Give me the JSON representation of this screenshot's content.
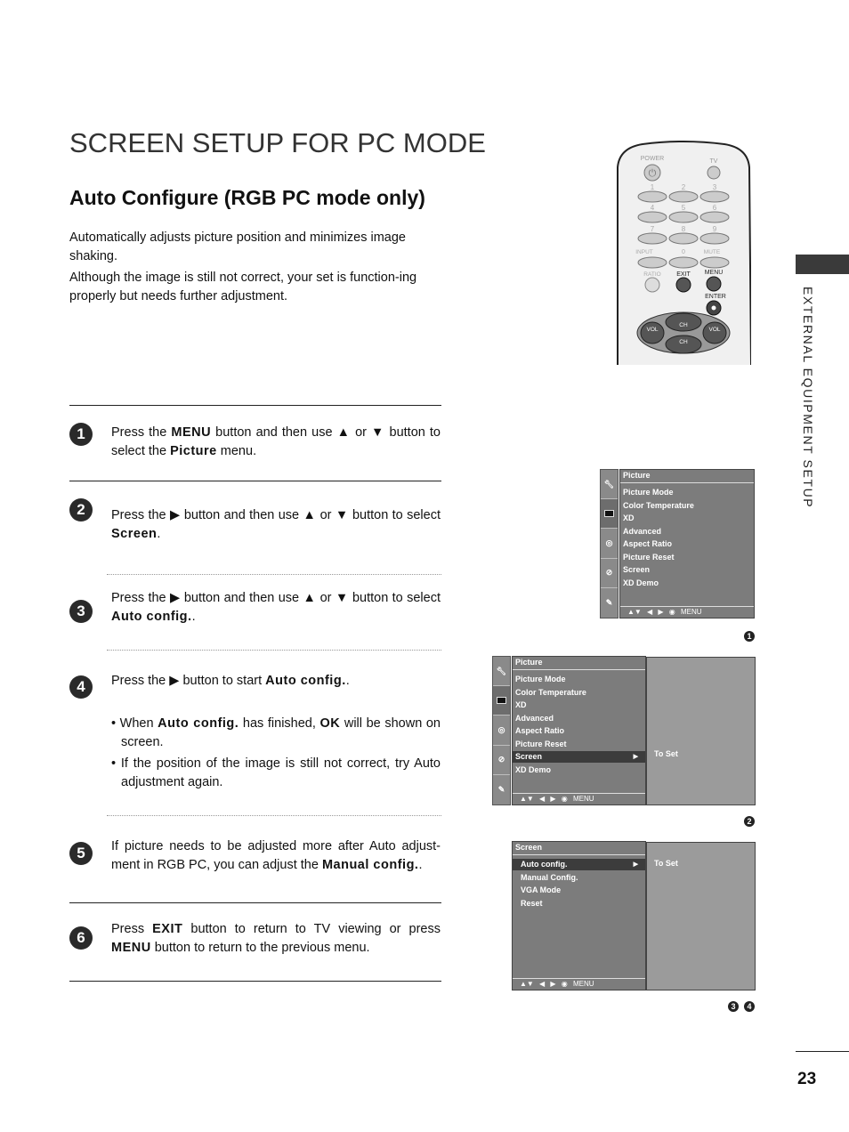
{
  "page": {
    "title": "SCREEN SETUP FOR PC MODE",
    "section_title": "Auto Configure (RGB PC mode only)",
    "intro": [
      "Automatically adjusts picture position and minimizes image shaking.",
      "Although the image is still not correct, your set is function-ing properly but needs further adjustment."
    ],
    "side_label": "EXTERNAL EQUIPMENT SETUP",
    "page_number": "23"
  },
  "steps": [
    {
      "num": "1",
      "parts": [
        "Press the ",
        "MENU",
        " button and then use ▲ or ▼ button to select the ",
        "Picture",
        " menu."
      ]
    },
    {
      "num": "2",
      "parts": [
        "Press the ▶ button and then use ▲ or ▼ button to select ",
        "Screen",
        "."
      ]
    },
    {
      "num": "3",
      "parts": [
        "Press the ▶ button and then use ▲ or ▼ button to select ",
        "Auto config.",
        "."
      ]
    },
    {
      "num": "4",
      "parts": [
        "Press the ▶ button to start ",
        "Auto config.",
        "."
      ],
      "bullets": [
        [
          "• When ",
          "Auto config.",
          " has finished, ",
          "OK",
          " will be shown on screen."
        ],
        [
          "• If the position of the image is still not correct, try Auto adjustment again."
        ]
      ]
    },
    {
      "num": "5",
      "parts": [
        "If picture needs to be adjusted more after Auto adjust-ment in RGB PC, you can adjust the ",
        "Manual config.",
        "."
      ]
    },
    {
      "num": "6",
      "parts": [
        "Press ",
        "EXIT",
        " button to return to TV viewing or press ",
        "MENU",
        " button to return to the previous menu."
      ]
    }
  ],
  "remote": {
    "power": "POWER",
    "tv": "TV",
    "digits": [
      "1",
      "2",
      "3",
      "4",
      "5",
      "6",
      "7",
      "8",
      "9"
    ],
    "input": "INPUT",
    "zero": "0",
    "mute": "MUTE",
    "ratio": "RATIO",
    "exit": "EXIT",
    "menu": "MENU",
    "enter": "ENTER",
    "ch": "CH",
    "vol": "VOL"
  },
  "osd1": {
    "header": "Picture",
    "items": [
      "Picture Mode",
      "Color Temperature",
      "XD",
      "Advanced",
      "Aspect Ratio",
      "Picture Reset",
      "Screen",
      "XD Demo"
    ],
    "footer": "▲▼ ◀ ▶ ◉ MENU",
    "badge": "1"
  },
  "osd2": {
    "header": "Picture",
    "items": [
      "Picture Mode",
      "Color Temperature",
      "XD",
      "Advanced",
      "Aspect Ratio",
      "Picture Reset",
      "Screen",
      "XD Demo"
    ],
    "selected_index": 6,
    "footer": "▲▼ ◀ ▶ ◉ MENU",
    "sub_text": "To Set",
    "badge": "2"
  },
  "osd3": {
    "header": "Screen",
    "items": [
      "Auto config.",
      "Manual Config.",
      "VGA Mode",
      "Reset"
    ],
    "selected_index": 0,
    "footer": "▲▼ ◀ ▶ ◉ MENU",
    "sub_text": "To Set",
    "badges": [
      "3",
      "4"
    ]
  }
}
